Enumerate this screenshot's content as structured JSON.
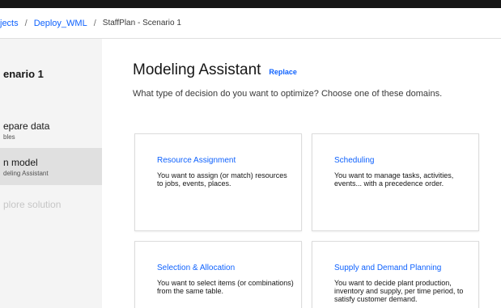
{
  "breadcrumb": {
    "items": [
      "jects",
      "Deploy_WML"
    ],
    "current": "StaffPlan - Scenario 1",
    "separator": "/"
  },
  "sidebar": {
    "scenario_title": "enario 1",
    "steps": [
      {
        "label": "epare data",
        "sub": "bles"
      },
      {
        "label": "n model",
        "sub": "deling Assistant"
      },
      {
        "label": "plore solution",
        "sub": ""
      }
    ]
  },
  "main": {
    "title": "Modeling Assistant",
    "replace_label": "Replace",
    "subtitle": "What type of decision do you want to optimize? Choose one of these domains.",
    "cards": [
      {
        "title": "Resource Assignment",
        "description": "You want to assign (or match) resources to jobs, events, places."
      },
      {
        "title": "Scheduling",
        "description": "You want to manage tasks, activities, events... with a precedence order."
      },
      {
        "title": "Selection & Allocation",
        "description": "You want to select items (or combinations) from the same table."
      },
      {
        "title": "Supply and Demand Planning",
        "description": "You want to decide plant production, inventory and supply, per time period, to satisfy customer demand."
      }
    ]
  },
  "colors": {
    "accent": "#0f62fe",
    "topbar": "#161616",
    "sidebar_bg": "#f4f4f4",
    "sidebar_active_bg": "#e0e0e0"
  }
}
